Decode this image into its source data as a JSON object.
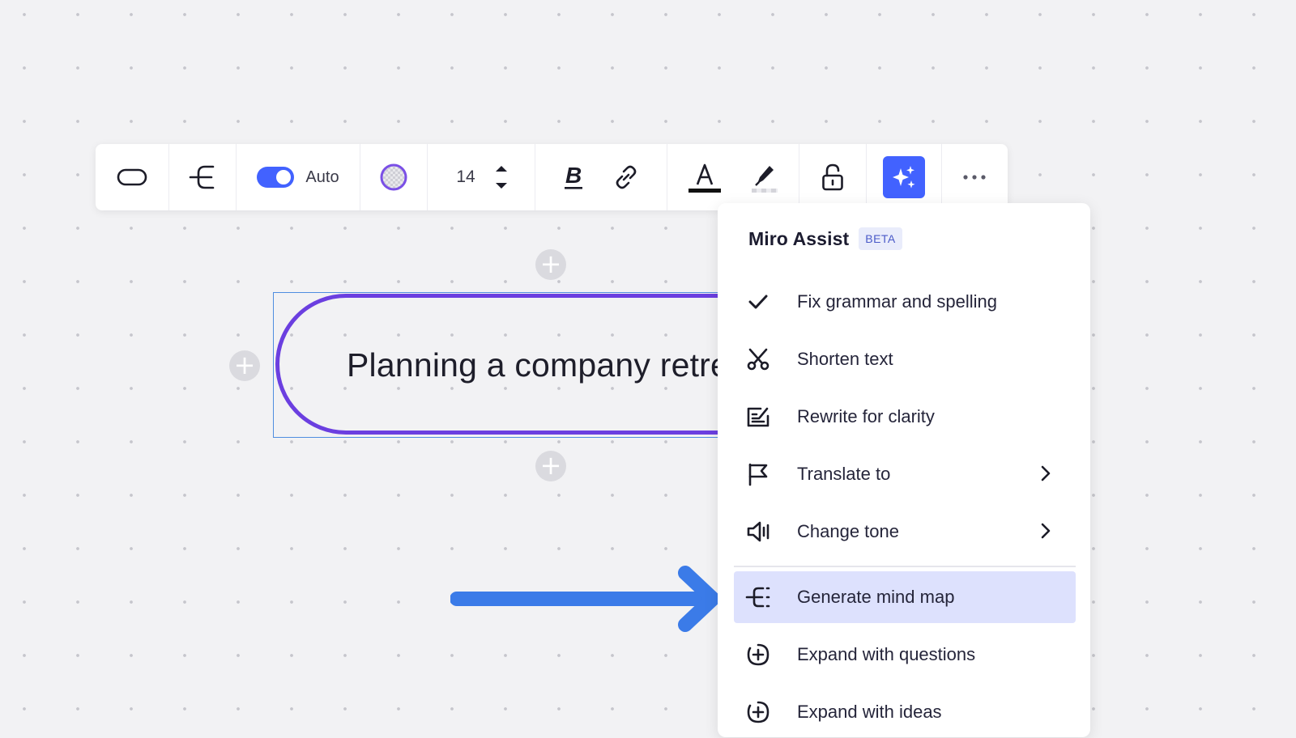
{
  "toolbar": {
    "auto_label": "Auto",
    "auto_toggle_on": true,
    "font_size": "14",
    "fill_color": "#b9a4f0",
    "accent_color": "#4262ff"
  },
  "canvas": {
    "shape_text": "Planning a company retre",
    "shape_border_color": "#6b3fe0",
    "arrow_color": "#3b7be8"
  },
  "menu": {
    "title": "Miro Assist",
    "badge": "BETA",
    "items": [
      {
        "label": "Fix grammar and spelling",
        "icon": "check-icon"
      },
      {
        "label": "Shorten text",
        "icon": "scissors-icon"
      },
      {
        "label": "Rewrite for clarity",
        "icon": "rewrite-icon"
      },
      {
        "label": "Translate to",
        "icon": "flag-icon",
        "has_submenu": true
      },
      {
        "label": "Change tone",
        "icon": "speaker-icon",
        "has_submenu": true
      },
      {
        "label": "Generate mind map",
        "icon": "mind-map-icon",
        "selected": true
      },
      {
        "label": "Expand with questions",
        "icon": "plus-bubble-icon"
      },
      {
        "label": "Expand with ideas",
        "icon": "plus-bubble-icon"
      }
    ]
  }
}
